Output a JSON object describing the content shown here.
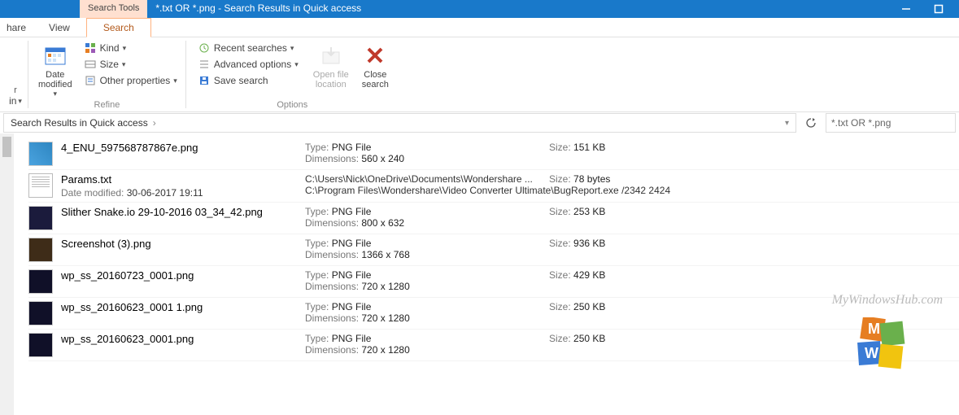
{
  "title": {
    "tool_tab": "Search Tools",
    "text": "*.txt OR *.png - Search Results in Quick access"
  },
  "tabs": {
    "share": "hare",
    "view": "View",
    "search": "Search"
  },
  "ribbon": {
    "location": {
      "in_label": "in",
      "group_label": ""
    },
    "refine": {
      "date": "Date\nmodified",
      "kind": "Kind",
      "size": "Size",
      "other": "Other properties",
      "group_label": "Refine"
    },
    "options": {
      "recent": "Recent searches",
      "advanced": "Advanced options",
      "save": "Save search",
      "openfile": "Open file\nlocation",
      "close": "Close\nsearch",
      "group_label": "Options"
    }
  },
  "address": {
    "crumb": "Search Results in Quick access"
  },
  "searchbox": {
    "value": "*.txt OR *.png"
  },
  "results": [
    {
      "thumb": "img",
      "name": "4_ENU_597568787867e.png",
      "sub": "",
      "type_label": "Type:",
      "type_val": "PNG File",
      "dim_label": "Dimensions:",
      "dim_val": "560 x 240",
      "size_label": "Size:",
      "size_val": "151 KB"
    },
    {
      "thumb": "doc",
      "name": "Params.txt",
      "sub_label": "Date modified:",
      "sub_val": "30-06-2017 19:11",
      "line1": "C:\\Users\\Nick\\OneDrive\\Documents\\Wondershare ...",
      "line2": "C:\\Program Files\\Wondershare\\Video Converter Ultimate\\BugReport.exe /2342 2424",
      "size_label": "Size:",
      "size_val": "78 bytes"
    },
    {
      "thumb": "img",
      "name": "Slither Snake.io 29-10-2016 03_34_42.png",
      "sub": "",
      "type_label": "Type:",
      "type_val": "PNG File",
      "dim_label": "Dimensions:",
      "dim_val": "800 x 632",
      "size_label": "Size:",
      "size_val": "253 KB"
    },
    {
      "thumb": "img",
      "name": "Screenshot (3).png",
      "sub": "",
      "type_label": "Type:",
      "type_val": "PNG File",
      "dim_label": "Dimensions:",
      "dim_val": "1366 x 768",
      "size_label": "Size:",
      "size_val": "936 KB"
    },
    {
      "thumb": "img",
      "name": "wp_ss_20160723_0001.png",
      "sub": "",
      "type_label": "Type:",
      "type_val": "PNG File",
      "dim_label": "Dimensions:",
      "dim_val": "720 x 1280",
      "size_label": "Size:",
      "size_val": "429 KB"
    },
    {
      "thumb": "img",
      "name": "wp_ss_20160623_0001 1.png",
      "sub": "",
      "type_label": "Type:",
      "type_val": "PNG File",
      "dim_label": "Dimensions:",
      "dim_val": "720 x 1280",
      "size_label": "Size:",
      "size_val": "250 KB"
    },
    {
      "thumb": "img",
      "name": "wp_ss_20160623_0001.png",
      "sub": "",
      "type_label": "Type:",
      "type_val": "PNG File",
      "dim_label": "Dimensions:",
      "dim_val": "720 x 1280",
      "size_label": "Size:",
      "size_val": "250 KB"
    }
  ],
  "watermark": "MyWindowsHub.com"
}
